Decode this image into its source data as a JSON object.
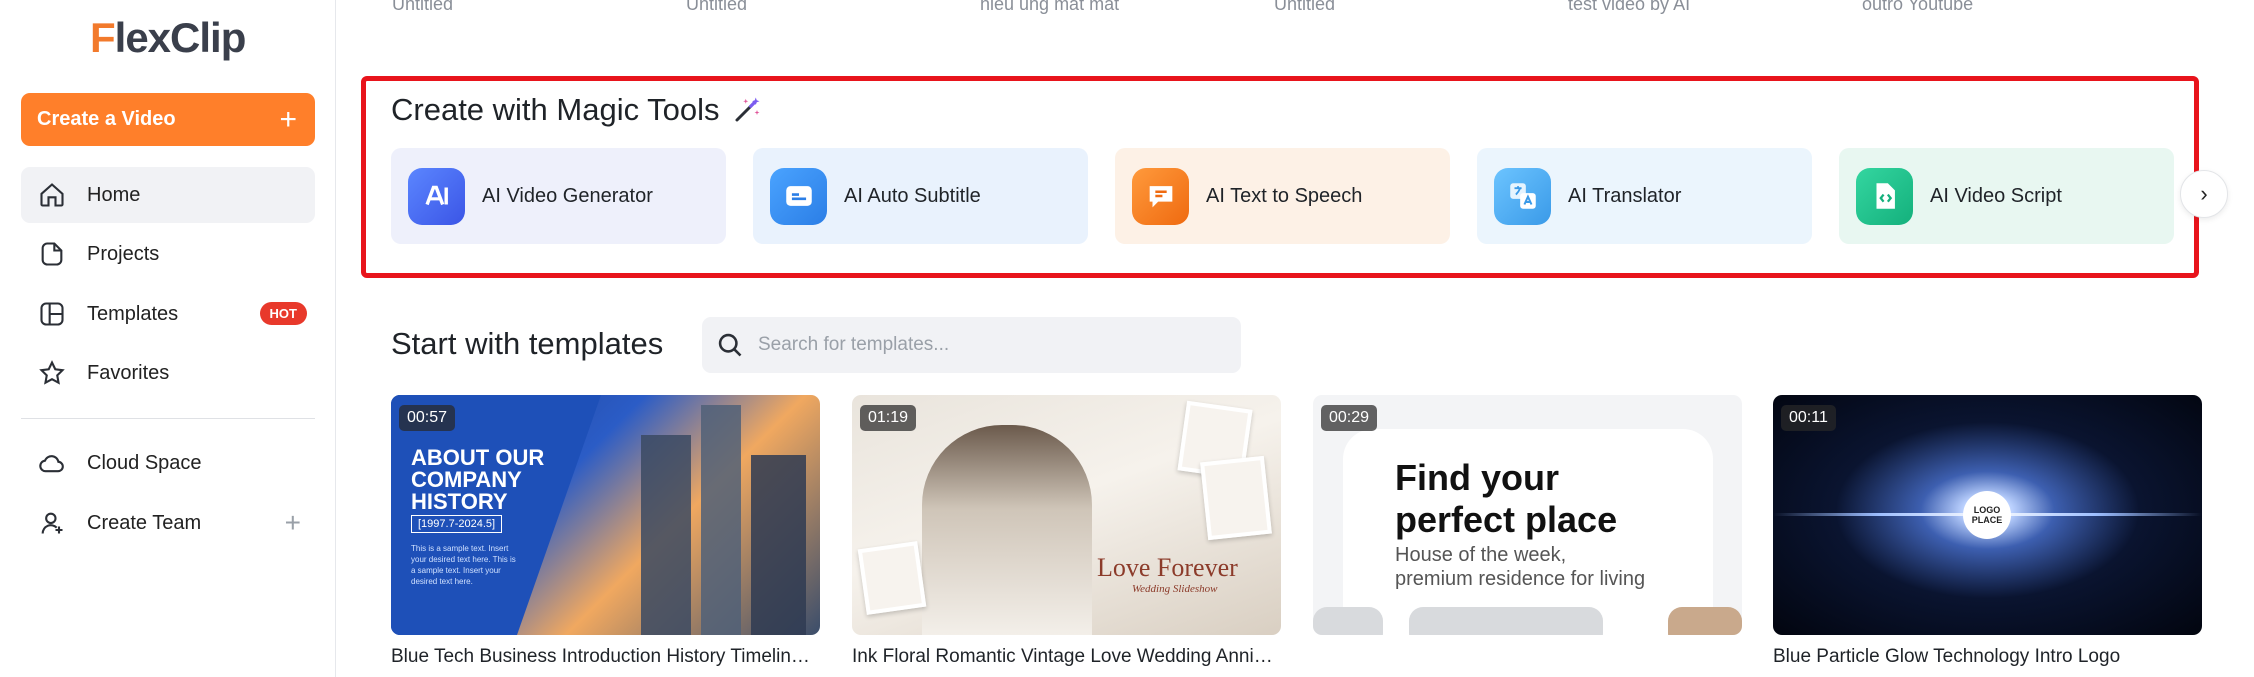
{
  "brand": {
    "logo_first": "F",
    "logo_rest": "lexClip",
    "accent": "#ff7f2a"
  },
  "sidebar": {
    "create_label": "Create a Video",
    "create_plus": "+",
    "items": [
      {
        "label": "Home",
        "icon": "home-icon",
        "active": true
      },
      {
        "label": "Projects",
        "icon": "projects-icon"
      },
      {
        "label": "Templates",
        "icon": "templates-icon",
        "badge": "HOT"
      },
      {
        "label": "Favorites",
        "icon": "star-icon"
      },
      {
        "label": "Cloud Space",
        "icon": "cloud-icon"
      },
      {
        "label": "Create Team",
        "icon": "add-user-icon",
        "action": "+"
      }
    ]
  },
  "recent_projects": [
    "Untitled",
    "Untitled",
    "hieu ung mat mat",
    "Untitled",
    "test video by AI",
    "outro Youtube"
  ],
  "magic_tools": {
    "title": "Create with Magic Tools",
    "highlight_color": "#e8141c",
    "tools": [
      {
        "label": "AI Video Generator",
        "icon": "ai-icon",
        "bg": "#eef0fb",
        "icon_bg": "#3b6cf0"
      },
      {
        "label": "AI Auto Subtitle",
        "icon": "subtitle-icon",
        "bg": "#e9f2fd",
        "icon_bg": "#2f8be8"
      },
      {
        "label": "AI Text to Speech",
        "icon": "speech-bubble-icon",
        "bg": "#fdf1e6",
        "icon_bg": "#f07d1a"
      },
      {
        "label": "AI Translator",
        "icon": "translate-icon",
        "bg": "#ebf5fd",
        "icon_bg": "#44a8ee"
      },
      {
        "label": "AI Video Script",
        "icon": "script-icon",
        "bg": "#e8f7f1",
        "icon_bg": "#1fc08a"
      }
    ],
    "next_arrow": "›"
  },
  "templates": {
    "title": "Start with templates",
    "search_placeholder": "Search for templates...",
    "items": [
      {
        "duration": "00:57",
        "title": "Blue Tech Business Introduction History Timeline ...",
        "art_heading": "ABOUT OUR\nCOMPANY\nHISTORY",
        "art_year": "[1997.7-2024.5]",
        "art_small": "This is a sample text. Insert your desired text here. This is a sample text. Insert your desired text here."
      },
      {
        "duration": "01:19",
        "title": "Ink Floral Romantic Vintage Love Wedding Annive...",
        "art_heading": "Love Forever",
        "art_sub": "Wedding Slideshow"
      },
      {
        "duration": "00:29",
        "title": "",
        "art_heading": "Find your\nperfect place",
        "art_sub": "House of the week,\npremium residence for living"
      },
      {
        "duration": "00:11",
        "title": "Blue Particle Glow Technology Intro Logo",
        "art_logo": "LOGO\nPLACE"
      }
    ]
  }
}
